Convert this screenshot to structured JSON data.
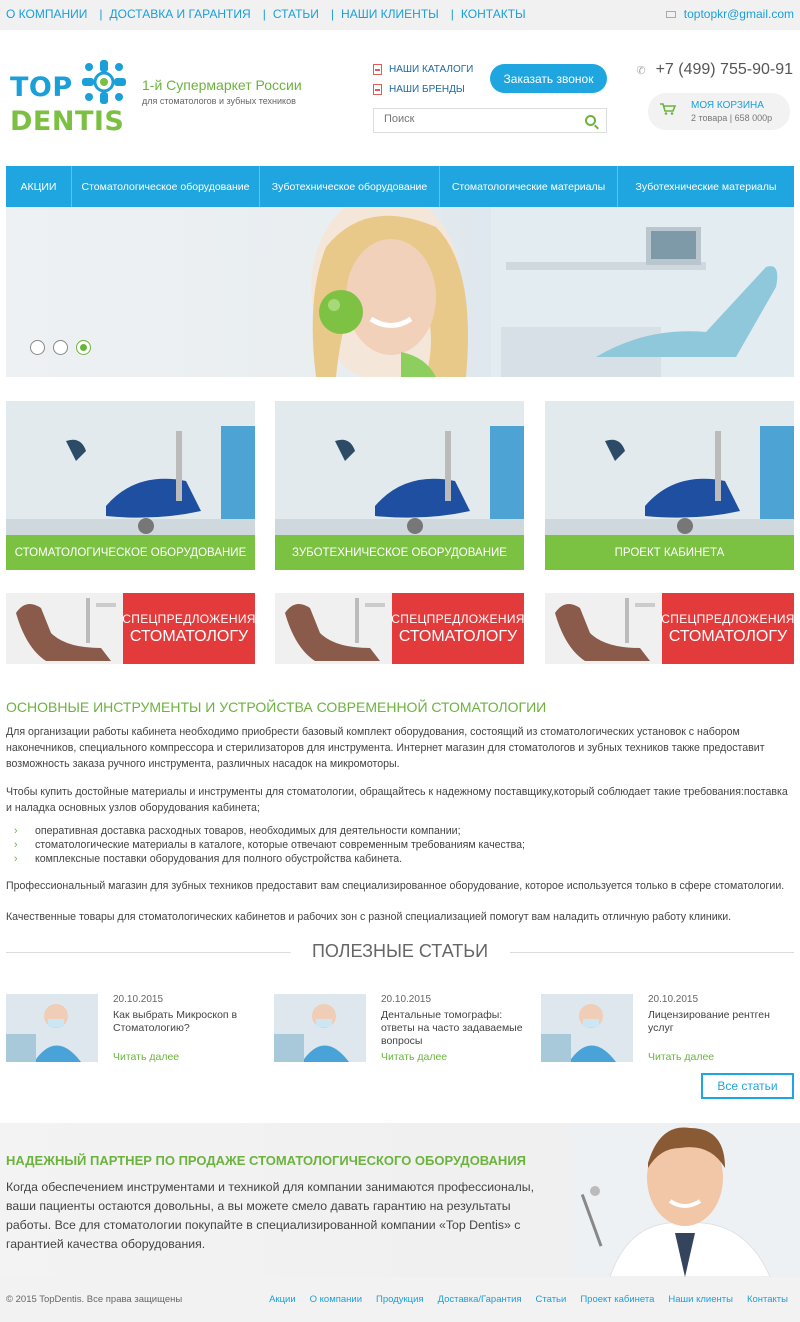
{
  "topbar": {
    "nav": [
      "О компании",
      "Доставка и гарантия",
      "Статьи",
      "Наши клиенты",
      "Контакты"
    ],
    "email": "toptopkr@gmail.com"
  },
  "header": {
    "logo_top": "TOP",
    "logo_bottom": "DENTIS",
    "slogan_title": "1-й Супермаркет России",
    "slogan_sub": "для стоматологов и зубных техников",
    "catalogs_link": "Наши каталоги",
    "brands_link": "Наши бренды",
    "call_button": "Заказать звонок",
    "search_placeholder": "Поиск",
    "phone": "+7 (499) 755-90-91",
    "cart_title": "Моя корзина",
    "cart_info": "2 товара | 658 000р"
  },
  "mainnav": [
    "АКЦИИ",
    "Стоматологическое оборудование",
    "Зуботехническое оборудование",
    "Стоматологические материалы",
    "Зуботехнические материалы"
  ],
  "hero": {
    "slides": 3,
    "active_slide": 3
  },
  "categories": [
    "Стоматологическое оборудование",
    "Зуботехническое оборудование",
    "Проект кабинета"
  ],
  "promo": {
    "line1": "СПЕЦПРЕДЛОЖЕНИЯ",
    "line2": "СТОМАТОЛОГУ"
  },
  "content": {
    "heading": "Основные инструменты и устройства современной стоматологии",
    "p1": "Для организации работы кабинета необходимо приобрести базовый комплект оборудования, состоящий из стоматологических установок с набором наконечников, специального компрессора и стерилизаторов для инструмента. Интернет магазин для стоматологов и зубных техников также предоставит возможность заказа ручного инструмента, различных насадок на микромоторы.",
    "p2": "Чтобы купить достойные материалы и инструменты для стоматологии, обращайтесь к надежному поставщику,который соблюдает такие требования:поставка и наладка основных узлов оборудования кабинета;",
    "bullets": [
      "оперативная доставка расходных товаров, необходимых для деятельности компании;",
      "стоматологические материалы в каталоге, которые отвечают современным требованиям качества;",
      "комплексные поставки оборудования для полного обустройства кабинета."
    ],
    "p3": "Профессиональный магазин для зубных техников предоставит вам специализированное оборудование, которое используется только в сфере стоматологии.",
    "p4": "Качественные товары для стоматологических кабинетов и рабочих зон с разной специализацией помогут вам наладить отличную работу клиники."
  },
  "articles": {
    "title": "ПОЛЕЗНЫЕ СТАТЬИ",
    "items": [
      {
        "date": "20.10.2015",
        "title": "Как выбрать Микроскоп в Стоматологию?",
        "more": "Читать далее"
      },
      {
        "date": "20.10.2015",
        "title": "Дентальные томографы: ответы на часто задаваемые вопросы",
        "more": "Читать далее"
      },
      {
        "date": "20.10.2015",
        "title": "Лицензирование рентген услуг",
        "more": "Читать далее"
      }
    ],
    "all_button": "Все статьи"
  },
  "partner": {
    "heading": "Надежный партнер по продаже стоматологического оборудования",
    "text": "Когда обеспечением инструментами и техникой для компании занимаются профессионалы, ваши пациенты остаются довольны, а вы можете смело давать гарантию на результаты работы. Все для стоматологии покупайте в специализированной компании «Top Dentis» с гарантией качества оборудования."
  },
  "footer": {
    "copyright": "© 2015 TopDentis. Все права защищены",
    "nav": [
      "Акции",
      "О компании",
      "Продукция",
      "Доставка/Гарантия",
      "Статьи",
      "Проект кабинета",
      "Наши клиенты",
      "Контакты"
    ]
  },
  "colors": {
    "blue": "#1fa6e0",
    "green": "#7cc242",
    "red": "#e33b3b"
  }
}
